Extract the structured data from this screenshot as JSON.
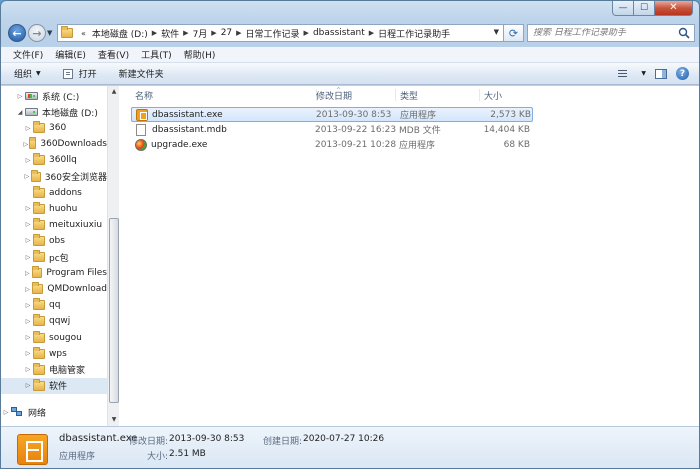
{
  "address": {
    "crumbs": [
      "本地磁盘 (D:)",
      "软件",
      "7月",
      "27",
      "日常工作记录",
      "dbassistant",
      "日程工作记录助手"
    ],
    "overflow_chevron": "«"
  },
  "search": {
    "placeholder": "搜索 日程工作记录助手"
  },
  "menu": [
    "文件(F)",
    "编辑(E)",
    "查看(V)",
    "工具(T)",
    "帮助(H)"
  ],
  "toolbar": {
    "organize": "组织",
    "open": "打开",
    "new_folder": "新建文件夹"
  },
  "nav": {
    "items": [
      {
        "label": "系统 (C:)",
        "kind": "drive-win",
        "arrow": "▷"
      },
      {
        "label": "本地磁盘 (D:)",
        "kind": "drive",
        "arrow": "◢"
      },
      {
        "label": "360",
        "kind": "folder",
        "arrow": "▷"
      },
      {
        "label": "360Downloads",
        "kind": "folder",
        "arrow": "▷"
      },
      {
        "label": "360llq",
        "kind": "folder",
        "arrow": "▷"
      },
      {
        "label": "360安全浏览器",
        "kind": "folder",
        "arrow": "▷"
      },
      {
        "label": "addons",
        "kind": "folder",
        "arrow": ""
      },
      {
        "label": "huohu",
        "kind": "folder",
        "arrow": "▷"
      },
      {
        "label": "meituxiuxiu",
        "kind": "folder",
        "arrow": "▷"
      },
      {
        "label": "obs",
        "kind": "folder",
        "arrow": "▷"
      },
      {
        "label": "pc包",
        "kind": "folder",
        "arrow": "▷"
      },
      {
        "label": "Program Files",
        "kind": "folder",
        "arrow": "▷"
      },
      {
        "label": "QMDownload",
        "kind": "folder",
        "arrow": "▷"
      },
      {
        "label": "qq",
        "kind": "folder",
        "arrow": "▷"
      },
      {
        "label": "qqwj",
        "kind": "folder",
        "arrow": "▷"
      },
      {
        "label": "sougou",
        "kind": "folder",
        "arrow": "▷"
      },
      {
        "label": "wps",
        "kind": "folder",
        "arrow": "▷"
      },
      {
        "label": "电脑管家",
        "kind": "folder",
        "arrow": "▷"
      },
      {
        "label": "软件",
        "kind": "folder",
        "arrow": "▷",
        "selected": true
      }
    ],
    "network": "网络"
  },
  "columns": {
    "name": "名称",
    "modified": "修改日期",
    "type": "类型",
    "size": "大小"
  },
  "files": [
    {
      "name": "dbassistant.exe",
      "modified": "2013-09-30 8:53",
      "type": "应用程序",
      "size": "2,573 KB",
      "icon": "exe-icon",
      "selected": true
    },
    {
      "name": "dbassistant.mdb",
      "modified": "2013-09-22 16:23",
      "type": "MDB 文件",
      "size": "14,404 KB",
      "icon": "doc-icon",
      "selected": false
    },
    {
      "name": "upgrade.exe",
      "modified": "2013-09-21 10:28",
      "type": "应用程序",
      "size": "68 KB",
      "icon": "upd-icon",
      "selected": false
    }
  ],
  "details": {
    "name": "dbassistant.exe",
    "type": "应用程序",
    "modified_label": "修改日期:",
    "modified": "2013-09-30 8:53",
    "created_label": "创建日期:",
    "created": "2020-07-27 10:26",
    "size_label": "大小:",
    "size": "2.51 MB"
  },
  "colors": {
    "selection": "#d3e6fb",
    "selection_border": "#84acdd",
    "window_frame": "#b8d0e8"
  }
}
